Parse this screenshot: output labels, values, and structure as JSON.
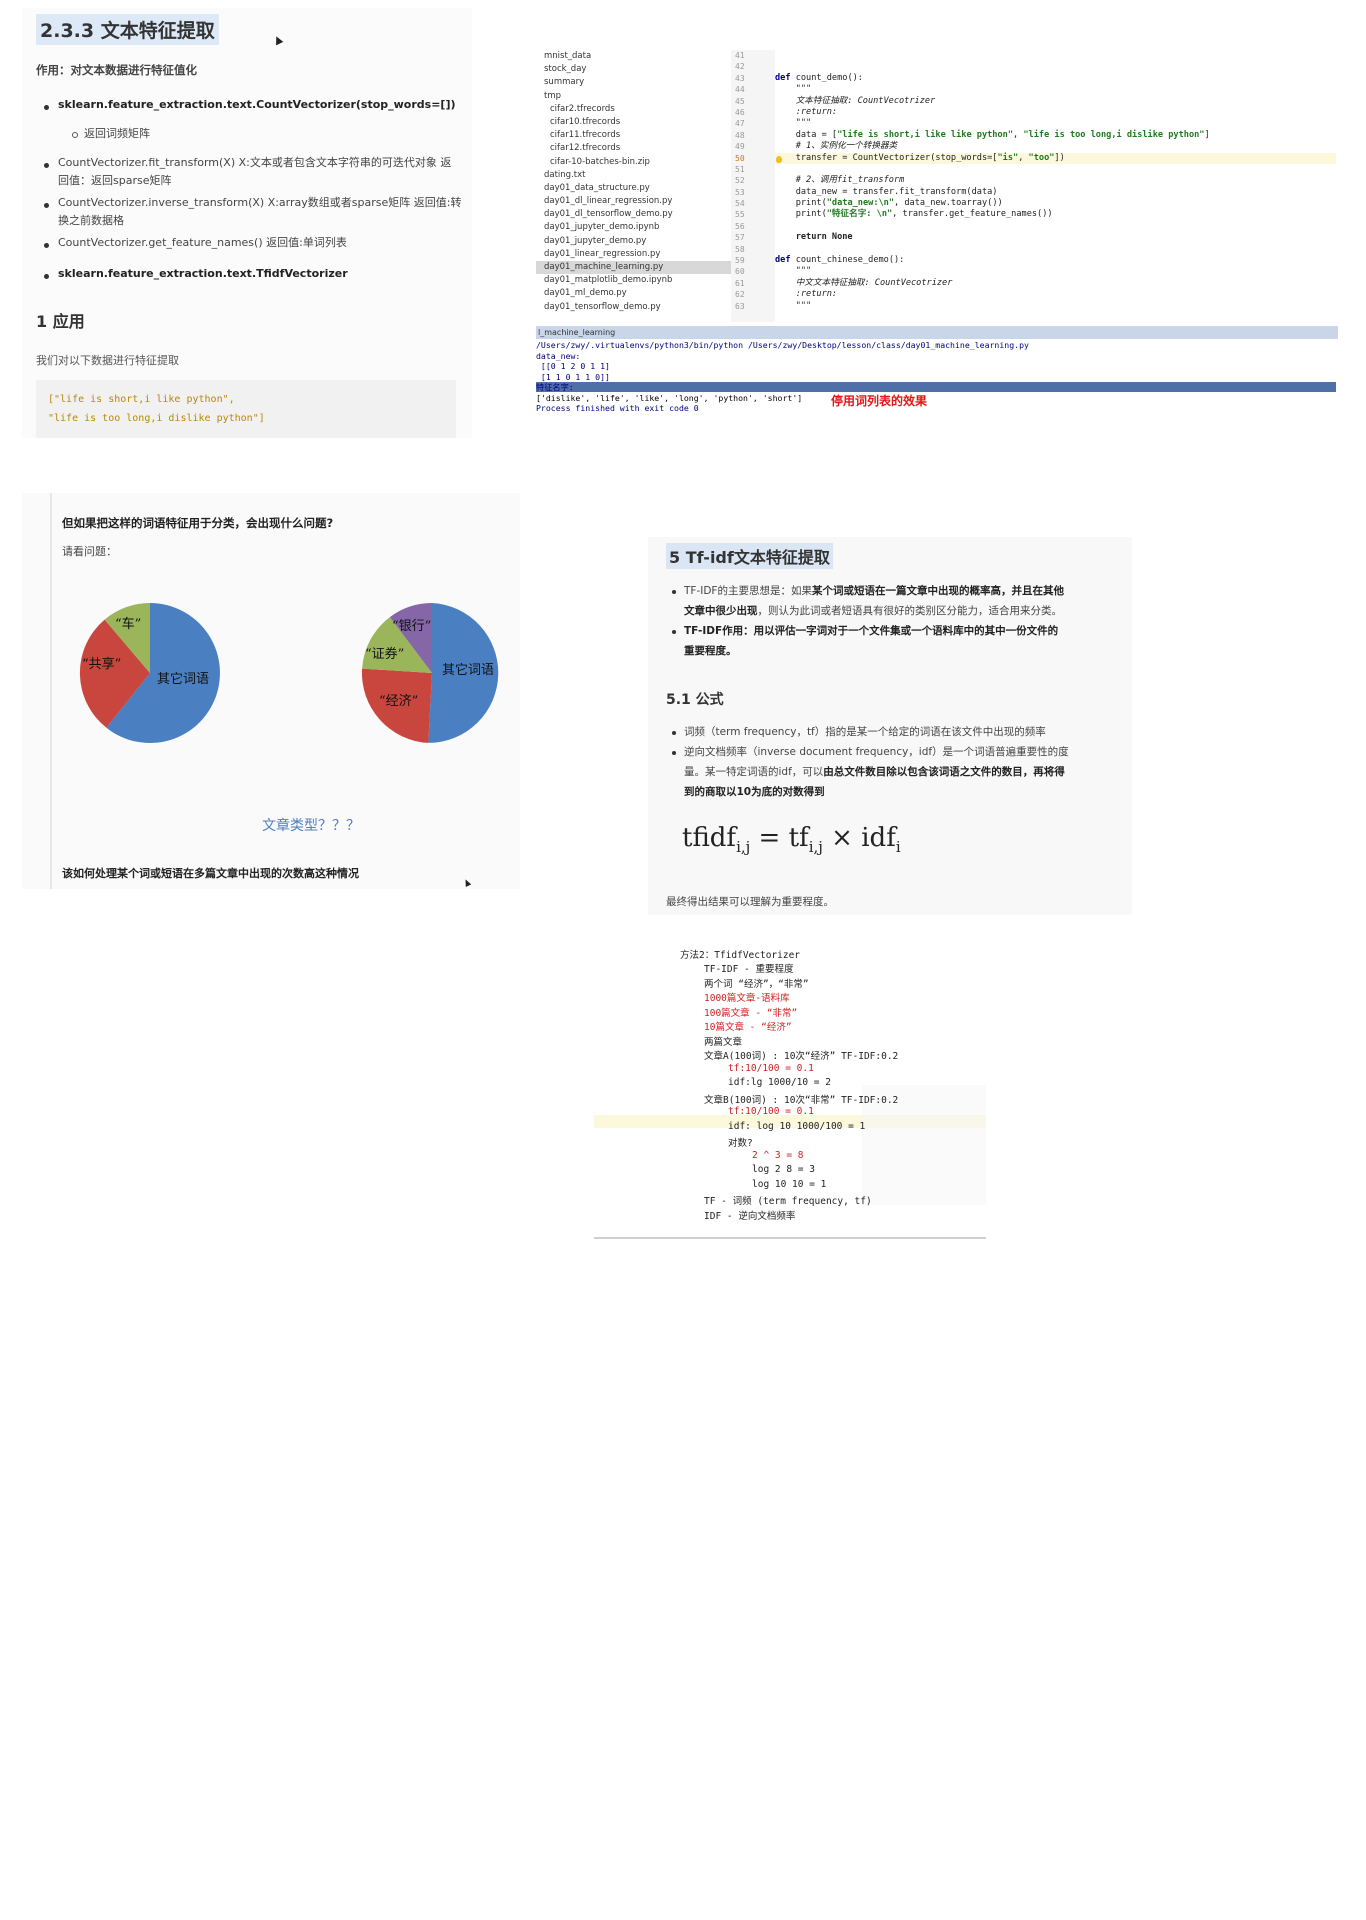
{
  "panel1": {
    "title": "2.3.3 文本特征提取",
    "intro": "作用：对文本数据进行特征值化",
    "bullet_api": "sklearn.feature_extraction.text.CountVectorizer(stop_words=[])",
    "sub_bullet": "返回词频矩阵",
    "items": [
      "CountVectorizer.fit_transform(X) X:文本或者包含文本字符串的可迭代对象 返",
      "回值：返回sparse矩阵",
      "CountVectorizer.inverse_transform(X) X:array数组或者sparse矩阵 返回值:转",
      "换之前数据格",
      "CountVectorizer.get_feature_names() 返回值:单词列表"
    ],
    "bullet_tfidf": "sklearn.feature_extraction.text.TfidfVectorizer",
    "section": "1 应用",
    "desc": "我们对以下数据进行特征提取",
    "code": [
      "[\"life is short,i like python\",",
      "\"life is too long,i dislike python\"]"
    ]
  },
  "panel2": {
    "files": [
      "mnist_data",
      "stock_day",
      "summary",
      "tmp",
      "cifar2.tfrecords",
      "cifar10.tfrecords",
      "cifar11.tfrecords",
      "cifar12.tfrecords",
      "cifar-10-batches-bin.zip",
      "dating.txt",
      "day01_data_structure.py",
      "day01_dl_linear_regression.py",
      "day01_dl_tensorflow_demo.py",
      "day01_jupyter_demo.ipynb",
      "day01_jupyter_demo.py",
      "day01_linear_regression.py",
      "day01_machine_learning.py",
      "day01_matplotlib_demo.ipynb",
      "day01_ml_demo.py",
      "day01_tensorflow_demo.py"
    ],
    "line_numbers": [
      "41",
      "42",
      "43",
      "44",
      "45",
      "46",
      "47",
      "48",
      "49",
      "50",
      "51",
      "52",
      "53",
      "54",
      "55",
      "56",
      "57",
      "58",
      "59",
      "60",
      "61",
      "62",
      "63"
    ],
    "code": {
      "l43_kw": "def",
      "l43": " count_demo():",
      "l44": "    \"\"\"",
      "l45": "    文本特征抽取: CountVecotrizer",
      "l46": "    :return:",
      "l47": "    \"\"\"",
      "l48_a": "    data = [",
      "l48_s1": "\"life is short,i like like python\"",
      "l48_b": ", ",
      "l48_s2": "\"life is too long,i dislike python\"",
      "l48_c": "]",
      "l49": "    # 1、实例化一个转换器类",
      "l50_a": "    transfer = CountVectorizer(stop_words=[",
      "l50_s1": "\"is\"",
      "l50_b": ", ",
      "l50_s2": "\"too\"",
      "l50_c": "])",
      "l52": "    # 2、调用fit_transform",
      "l53": "    data_new = transfer.fit_transform(data)",
      "l54_a": "    print(",
      "l54_s": "\"data_new:\\n\"",
      "l54_b": ", data_new.toarray())",
      "l55_a": "    print(",
      "l55_s": "\"特征名字: \\n\"",
      "l55_b": ", transfer.get_feature_names())",
      "l57_kw": "    return None",
      "l59_kw": "def",
      "l59": " count_chinese_demo():",
      "l60": "    \"\"\"",
      "l61": "    中文文本特征抽取: CountVecotrizer",
      "l62": "    :return:",
      "l63": "    \"\"\""
    },
    "run_tab": "l_machine_learning",
    "console": [
      "/Users/zwy/.virtualenvs/python3/bin/python /Users/zwy/Desktop/lesson/class/day01_machine_learning.py",
      "data_new:",
      " [[0 1 2 0 1 1]",
      " [1 1 0 1 1 0]]",
      "特征名字:",
      "['dislike', 'life', 'like', 'long', 'python', 'short']",
      "",
      "Process finished with exit code 0"
    ],
    "note": "停用词列表的效果"
  },
  "panel3": {
    "question": "但如果把这样的词语特征用于分类，会出现什么问题?",
    "sub": "请看问题：",
    "pie1": [
      "“车”",
      "“共享”",
      "其它词语"
    ],
    "pie2": [
      "“银行”",
      "“证券”",
      "其它词语",
      "“经济”"
    ],
    "article_type": "文章类型？？？",
    "footer": "该如何处理某个词或短语在多篇文章中出现的次数高这种情况"
  },
  "panel4": {
    "title": "5 Tf-idf文本特征提取",
    "b1_l1a": "TF-IDF的主要思想是：如果",
    "b1_l1b": "某个词或短语在一篇文章中出现的概率高，并且在其他",
    "b1_l2a": "文章中很少出现",
    "b1_l2b": "，则认为此词或者短语具有很好的类别区分能力，适合用来分类。",
    "b2_l1": "TF-IDF作用：用以评估一字词对于一个文件集或一个语料库中的其中一份文件的",
    "b2_l2": "重要程度。",
    "h": "5.1 公式",
    "f1": "词频（term frequency，tf）指的是某一个给定的词语在该文件中出现的频率",
    "f2_l1": "逆向文档频率（inverse document frequency，idf）是一个词语普遍重要性的度",
    "f2_l2a": "量。某一特定词语的idf，可以",
    "f2_l2b": "由总文件数目除以包含该词语之文件的数目，再将得",
    "f2_l3": "到的商取以10为底的对数得到",
    "formula_lhs": "tfidf",
    "formula_tf": "tf",
    "formula_idf": "idf",
    "sub_ij": "i,j",
    "sub_i": "i",
    "eq": "=",
    "times": "×",
    "result": "最终得出结果可以理解为重要程度。"
  },
  "panel5": {
    "lines": [
      "方法2：TfidfVectorizer",
      "TF-IDF - 重要程度",
      "两个词 “经济”，“非常”",
      "1000篇文章-语料库",
      "100篇文章 - “非常”",
      "10篇文章 - “经济”",
      "两篇文章",
      "文章A(100词) : 10次“经济” TF-IDF:0.2",
      "tf:10/100 = 0.1",
      "idf:lg 1000/10 = 2",
      "文章B(100词) : 10次“非常” TF-IDF:0.2",
      "tf:10/100 = 0.1",
      "idf: log 10 1000/100 = 1",
      "对数?",
      "2 ^ 3 = 8",
      "log 2 8 = 3",
      "log 10 10 = 1",
      "TF - 词频 (term frequency, tf)",
      "IDF - 逆向文档频率"
    ]
  }
}
